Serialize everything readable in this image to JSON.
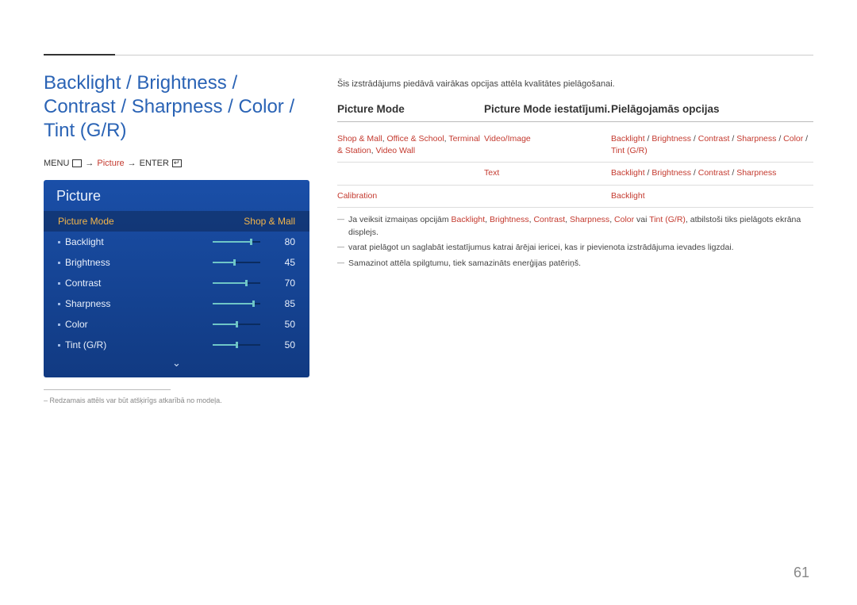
{
  "title": "Backlight / Brightness / Contrast / Sharpness / Color / Tint (G/R)",
  "menupath": {
    "menu": "MENU",
    "picture": "Picture",
    "enter": "ENTER",
    "arrow": "→"
  },
  "panel": {
    "title": "Picture",
    "mode_label": "Picture Mode",
    "mode_value": "Shop & Mall",
    "rows": [
      {
        "label": "Backlight",
        "value": 80
      },
      {
        "label": "Brightness",
        "value": 45
      },
      {
        "label": "Contrast",
        "value": 70
      },
      {
        "label": "Sharpness",
        "value": 85
      },
      {
        "label": "Color",
        "value": 50
      },
      {
        "label": "Tint (G/R)",
        "value": 50
      }
    ]
  },
  "footnote_left": "– Redzamais attēls var būt atšķirīgs atkarībā no modeļa.",
  "intro": "Šis izstrādājums piedāvā vairākas opcijas attēla kvalitātes pielāgošanai.",
  "table": {
    "head": [
      "Picture Mode",
      "Picture Mode iestatījumi.",
      "Pielāgojamās opcijas"
    ],
    "rows": [
      {
        "c1": [
          {
            "t": "Shop & Mall",
            "red": true
          },
          {
            "t": ", ",
            "red": false
          },
          {
            "t": "Office & School",
            "red": true
          },
          {
            "t": ", ",
            "red": false
          },
          {
            "t": "Terminal & Station",
            "red": true
          },
          {
            "t": ", ",
            "red": false
          },
          {
            "t": "Video Wall",
            "red": true
          }
        ],
        "c2": [
          {
            "t": "Video/Image",
            "red": true
          }
        ],
        "c3": [
          {
            "t": "Backlight",
            "red": true
          },
          {
            "t": " / ",
            "red": false
          },
          {
            "t": "Brightness",
            "red": true
          },
          {
            "t": " / ",
            "red": false
          },
          {
            "t": "Contrast",
            "red": true
          },
          {
            "t": " / ",
            "red": false
          },
          {
            "t": "Sharpness",
            "red": true
          },
          {
            "t": " / ",
            "red": false
          },
          {
            "t": "Color",
            "red": true
          },
          {
            "t": " / ",
            "red": false
          },
          {
            "t": "Tint (G/R)",
            "red": true
          }
        ]
      },
      {
        "c1": [
          {
            "t": "",
            "red": false
          }
        ],
        "c2": [
          {
            "t": "Text",
            "red": true
          }
        ],
        "c3": [
          {
            "t": "Backlight",
            "red": true
          },
          {
            "t": " / ",
            "red": false
          },
          {
            "t": "Brightness",
            "red": true
          },
          {
            "t": " / ",
            "red": false
          },
          {
            "t": "Contrast",
            "red": true
          },
          {
            "t": " / ",
            "red": false
          },
          {
            "t": "Sharpness",
            "red": true
          }
        ]
      },
      {
        "c1": [
          {
            "t": "Calibration",
            "red": true
          }
        ],
        "c2": [
          {
            "t": "",
            "red": false
          }
        ],
        "c3": [
          {
            "t": "Backlight",
            "red": true
          }
        ]
      }
    ]
  },
  "notes": [
    {
      "parts": [
        {
          "t": "Ja veiksit izmaiņas opcijām ",
          "red": false
        },
        {
          "t": "Backlight",
          "red": true
        },
        {
          "t": ", ",
          "red": false
        },
        {
          "t": "Brightness",
          "red": true
        },
        {
          "t": ", ",
          "red": false
        },
        {
          "t": "Contrast",
          "red": true
        },
        {
          "t": ", ",
          "red": false
        },
        {
          "t": "Sharpness",
          "red": true
        },
        {
          "t": ", ",
          "red": false
        },
        {
          "t": "Color",
          "red": true
        },
        {
          "t": " vai ",
          "red": false
        },
        {
          "t": "Tint (G/R)",
          "red": true
        },
        {
          "t": ", atbilstoši tiks pielāgots ekrāna displejs.",
          "red": false
        }
      ]
    },
    {
      "parts": [
        {
          "t": "varat pielāgot un saglabāt iestatījumus katrai ārējai iericei, kas ir pievienota izstrādājuma ievades ligzdai.",
          "red": false
        }
      ]
    },
    {
      "parts": [
        {
          "t": "Samazinot attēla spilgtumu, tiek samazināts enerģijas patēriņš.",
          "red": false
        }
      ]
    }
  ],
  "pagenum": "61"
}
